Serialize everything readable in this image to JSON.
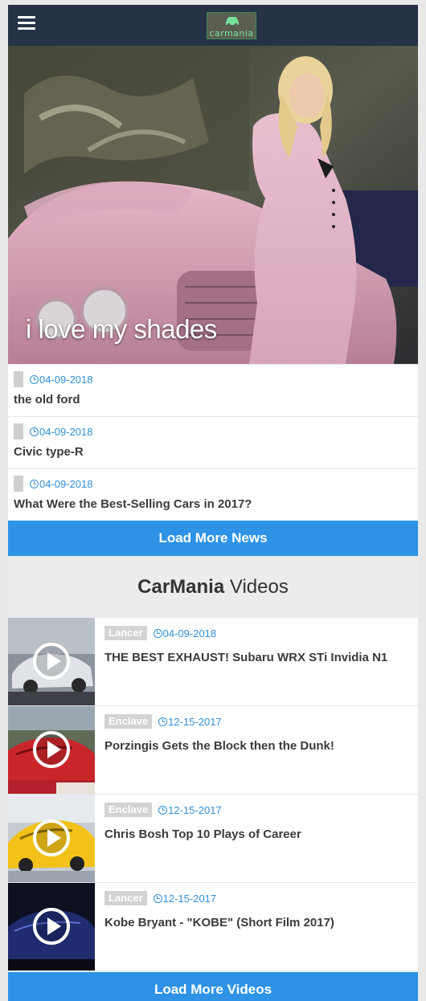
{
  "header": {
    "logo_text": "carmania"
  },
  "hero": {
    "caption": "i love my shades"
  },
  "news": [
    {
      "date": "04-09-2018",
      "title": "the old ford"
    },
    {
      "date": "04-09-2018",
      "title": "Civic type-R"
    },
    {
      "date": "04-09-2018",
      "title": "What Were the Best-Selling Cars in 2017?"
    }
  ],
  "load_more_news": "Load More News",
  "videos_section": {
    "brand": "CarMania",
    "label": "Videos"
  },
  "videos": [
    {
      "category": "Lancer",
      "date": "04-09-2018",
      "title": "THE BEST EXHAUST! Subaru WRX STi Invidia N1"
    },
    {
      "category": "Enclave",
      "date": "12-15-2017",
      "title": "Porzingis Gets the Block then the Dunk!"
    },
    {
      "category": "Enclave",
      "date": "12-15-2017",
      "title": "Chris Bosh Top 10 Plays of Career"
    },
    {
      "category": "Lancer",
      "date": "12-15-2017",
      "title": "Kobe Bryant - \"KOBE\" (Short Film 2017)"
    }
  ],
  "load_more_videos": "Load More Videos",
  "colors": {
    "navbar": "#263346",
    "accent": "#2e93e6",
    "date": "#2f8fd8"
  }
}
